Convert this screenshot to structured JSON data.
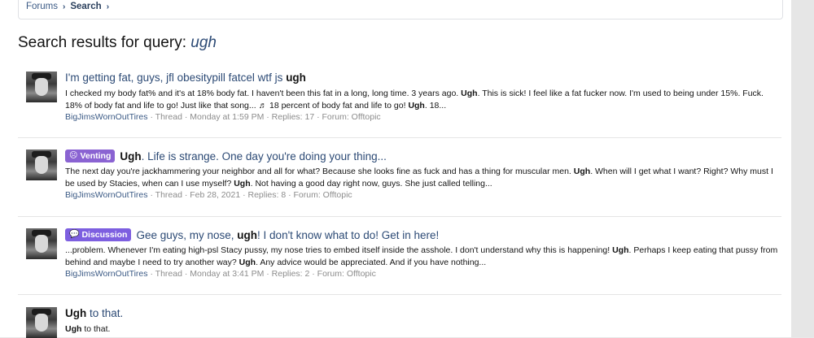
{
  "breadcrumb": {
    "items": [
      "Forums",
      "Search"
    ]
  },
  "page_title": {
    "prefix": "Search results for query:",
    "query": "ugh"
  },
  "results": [
    {
      "label": "",
      "title_pre": "I'm getting fat, guys, jfl obesitypill fatcel wtf js",
      "title_bold": "ugh",
      "title_post": "",
      "snippet": [
        {
          "t": "I checked my body fat% and it's at 18% body fat. I haven't been this fat in a long, long time. 3 years ago. "
        },
        {
          "b": "Ugh"
        },
        {
          "t": ". This is sick! I feel like a fat fucker now. I'm used to being under 15%. Fuck. 18% of body fat and life to go! Just like that song... ♬ 18 percent of body fat and life to go! "
        },
        {
          "b": "Ugh"
        },
        {
          "t": ". 18..."
        }
      ],
      "author": "BigJimsWornOutTires",
      "meta": " · Thread · Monday at 1:59 PM · Replies: 17 · Forum: Offtopic"
    },
    {
      "label": "Venting",
      "label_icon": "☹",
      "title_pre": "",
      "title_bold": "Ugh",
      "title_post": ". Life is strange. One day you're doing your thing...",
      "snippet": [
        {
          "t": "The next day you're jackhammering your neighbor and all for what? Because she looks fine as fuck and has a thing for muscular men. "
        },
        {
          "b": "Ugh"
        },
        {
          "t": ". When will I get what I want? Right? Why must I be used by Stacies, when can I use myself? "
        },
        {
          "b": "Ugh"
        },
        {
          "t": ". Not having a good day right now, guys. She just called telling..."
        }
      ],
      "author": "BigJimsWornOutTires",
      "meta": " · Thread · Feb 28, 2021 · Replies: 8 · Forum: Offtopic"
    },
    {
      "label": "Discussion",
      "label_icon": "💬",
      "title_pre": "Gee guys, my nose,",
      "title_bold": "ugh",
      "title_post": "! I don't know what to do! Get in here!",
      "snippet": [
        {
          "t": "...problem. Whenever I'm eating high-psl Stacy pussy, my nose tries to embed itself inside the asshole. I don't understand why this is happening! "
        },
        {
          "b": "Ugh"
        },
        {
          "t": ". Perhaps I keep eating that pussy from behind and maybe I need to try another way? "
        },
        {
          "b": "Ugh"
        },
        {
          "t": ". Any advice would be appreciated. And if you have nothing..."
        }
      ],
      "author": "BigJimsWornOutTires",
      "meta": " · Thread · Monday at 3:41 PM · Replies: 2 · Forum: Offtopic"
    },
    {
      "label": "",
      "title_pre": "",
      "title_bold": "Ugh",
      "title_post": "to that.",
      "snippet": [
        {
          "b": "Ugh"
        },
        {
          "t": " to that."
        }
      ],
      "author": "",
      "meta": ""
    }
  ]
}
